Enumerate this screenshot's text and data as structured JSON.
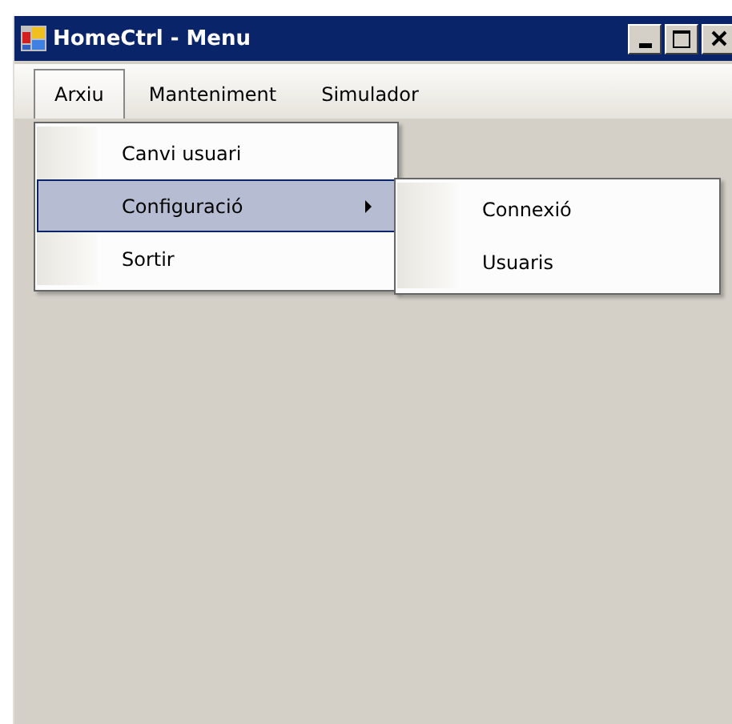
{
  "window": {
    "title": "HomeCtrl - Menu"
  },
  "menu_bar": [
    {
      "label": "Arxiu",
      "selected": true
    },
    {
      "label": "Manteniment",
      "selected": false
    },
    {
      "label": "Simulador",
      "selected": false
    }
  ],
  "dropdown": [
    {
      "label": "Canvi usuari",
      "selected": false,
      "submenu": false
    },
    {
      "label": "Configuració",
      "selected": true,
      "submenu": true
    },
    {
      "label": "Sortir",
      "selected": false,
      "submenu": false
    }
  ],
  "submenu": [
    {
      "label": "Connexió",
      "selected": false
    },
    {
      "label": "Usuaris",
      "selected": false
    }
  ]
}
